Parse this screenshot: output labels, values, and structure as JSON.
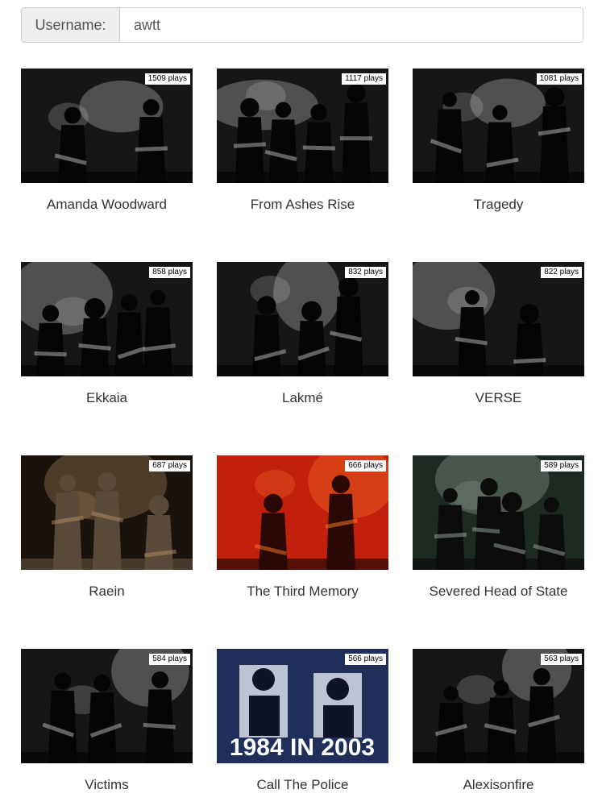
{
  "username": {
    "label": "Username:",
    "value": "awtt"
  },
  "artists": [
    {
      "name": "Amanda Woodward",
      "plays": "1509 plays",
      "photo": "bw"
    },
    {
      "name": "From Ashes Rise",
      "plays": "1117 plays",
      "photo": "bw"
    },
    {
      "name": "Tragedy",
      "plays": "1081 plays",
      "photo": "bw"
    },
    {
      "name": "Ekkaia",
      "plays": "858 plays",
      "photo": "bw"
    },
    {
      "name": "Lakmé",
      "plays": "832 plays",
      "photo": "bw"
    },
    {
      "name": "VERSE",
      "plays": "822 plays",
      "photo": "bw"
    },
    {
      "name": "Raein",
      "plays": "687 plays",
      "photo": "warm-dark"
    },
    {
      "name": "The Third Memory",
      "plays": "666 plays",
      "photo": "red"
    },
    {
      "name": "Severed Head of State",
      "plays": "589 plays",
      "photo": "color"
    },
    {
      "name": "Victims",
      "plays": "584 plays",
      "photo": "bw"
    },
    {
      "name": "Call The Police",
      "plays": "566 plays",
      "photo": "blue-poster",
      "poster_text": "1984 IN 2003"
    },
    {
      "name": "Alexisonfire",
      "plays": "563 plays",
      "photo": "bw"
    }
  ]
}
